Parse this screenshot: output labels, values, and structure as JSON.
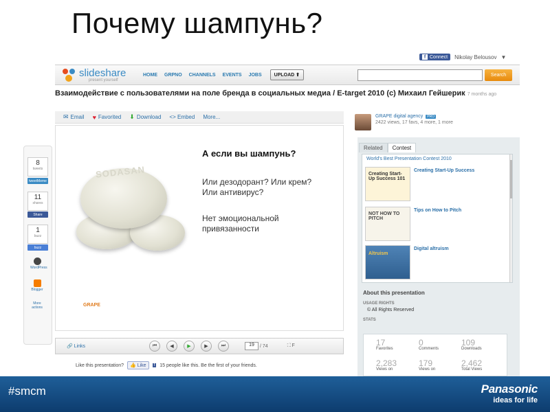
{
  "slide": {
    "title": "Почему шампунь?"
  },
  "userbar": {
    "connect_label": "Connect",
    "username": "Nikolay Belousov",
    "chevron": "▼"
  },
  "nav": {
    "logo": "slideshare",
    "logo_tagline": "present yourself",
    "items": [
      "HOME",
      "GRPNO",
      "CHANNELS",
      "EVENTS",
      "JOBS"
    ],
    "upload_label": "UPLOAD",
    "search_placeholder": "",
    "search_label": "Search"
  },
  "presentation": {
    "title": "Взаимодействие с пользователями на поле бренда в социальных медиа / E-target 2010 (с) Михаил Гейшерик",
    "ago": "7 months ago"
  },
  "actions": {
    "email": "Email",
    "favorite": "Favorited",
    "download": "Download",
    "embed": "<> Embed",
    "more": "More..."
  },
  "share_sidebar": {
    "count1": "8",
    "count1_label": "tweets",
    "btn1": "tweetMeme",
    "count2": "11",
    "count2_label": "shares",
    "btn2": "Share",
    "count3": "1",
    "count3_label": "buzz",
    "btn3": "buzz",
    "wordpress": "WordPress",
    "blogger": "Blogger",
    "more": "More actions"
  },
  "slide_content": {
    "question": "А если вы шампунь?",
    "text1": "Или дезодорант? Или крем? Или антивирус?",
    "text2": "Нет эмоциональной привязанности",
    "soap_brand": "SODASAN",
    "grape_logo": "GRAPE"
  },
  "player": {
    "link_label": "Links",
    "current_page": "19",
    "total_pages": "/ 74",
    "fullscreen": "F"
  },
  "like_bar": {
    "prompt": "Like this presentation?",
    "like_button": "Like",
    "like_text": "15 people like this. Be the first of your friends."
  },
  "author": {
    "name": "GRAPE digital agency",
    "pro_badge": "PRO",
    "stats": "2422 views, 17 favs, 4 more, 1 more"
  },
  "right_panel": {
    "tab_related": "Related",
    "tab_contest": "Contest",
    "contest_heading": "World's Best Presentation Contest 2010",
    "items": [
      {
        "thumb_text": "Creating Start-Up Success 101",
        "title": "Creating Start-Up Success"
      },
      {
        "thumb_text": "NOT HOW TO PITCH",
        "title": "Tips on How to Pitch"
      },
      {
        "thumb_text": "Altruism",
        "title": "Digital altruism"
      }
    ],
    "about_heading": "About this presentation",
    "usage_heading": "USAGE RIGHTS",
    "usage_value": "© All Rights Reserved",
    "stats_heading": "STATS",
    "stats": [
      {
        "value": "17",
        "label": "Favorites"
      },
      {
        "value": "0",
        "label": "Comments"
      },
      {
        "value": "109",
        "label": "Downloads"
      },
      {
        "value": "2,283",
        "label": "Views on"
      },
      {
        "value": "179",
        "label": "Views on"
      },
      {
        "value": "2,462",
        "label": "Total Views"
      }
    ]
  },
  "footer": {
    "hashtag": "#smcm",
    "brand": "Panasonic",
    "tagline": "ideas for life"
  }
}
